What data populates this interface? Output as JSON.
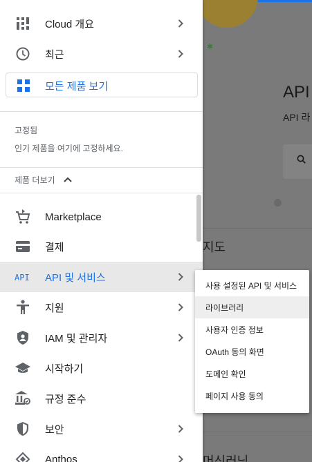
{
  "background": {
    "title": "API",
    "subtitle": "API 라",
    "section_heading_1": "지도",
    "section_heading_2": "머신러닝",
    "edge_text": "I"
  },
  "nav": {
    "top_items": [
      {
        "label": "Cloud 개요",
        "icon": "dashboard-icon",
        "has_chevron": true
      },
      {
        "label": "최근",
        "icon": "clock-icon",
        "has_chevron": true
      }
    ],
    "all_products": {
      "label": "모든 제품 보기",
      "icon": "grid-icon"
    },
    "pinned": {
      "title": "고정됨",
      "description": "인기 제품을 여기에 고정하세요."
    },
    "more_products": {
      "label": "제품 더보기",
      "icon": "chevron-up-icon"
    },
    "items": [
      {
        "label": "Marketplace",
        "icon": "cart-icon",
        "has_chevron": false
      },
      {
        "label": "결제",
        "icon": "billing-icon",
        "has_chevron": false
      },
      {
        "label": "API 및 서비스",
        "icon": "api-icon",
        "has_chevron": true,
        "active": true
      },
      {
        "label": "지원",
        "icon": "person-icon",
        "has_chevron": true
      },
      {
        "label": "IAM 및 관리자",
        "icon": "shield-person-icon",
        "has_chevron": true
      },
      {
        "label": "시작하기",
        "icon": "graduation-cap-icon",
        "has_chevron": false
      },
      {
        "label": "규정 준수",
        "icon": "compliance-icon",
        "has_chevron": false
      },
      {
        "label": "보안",
        "icon": "security-shield-icon",
        "has_chevron": true
      },
      {
        "label": "Anthos",
        "icon": "anthos-icon",
        "has_chevron": true
      }
    ],
    "api_icon_text": "API"
  },
  "flyout": {
    "items": [
      {
        "label": "사용 설정된 API 및 서비스"
      },
      {
        "label": "라이브러리",
        "hovered": true
      },
      {
        "label": "사용자 인증 정보"
      },
      {
        "label": "OAuth 동의 화면"
      },
      {
        "label": "도메인 확인"
      },
      {
        "label": "페이지 사용 동의"
      }
    ]
  },
  "colors": {
    "accent": "#1a73e8",
    "active_bg": "#e8e8e8",
    "icon": "#5f6368",
    "overlay": "#7a7a7a"
  }
}
